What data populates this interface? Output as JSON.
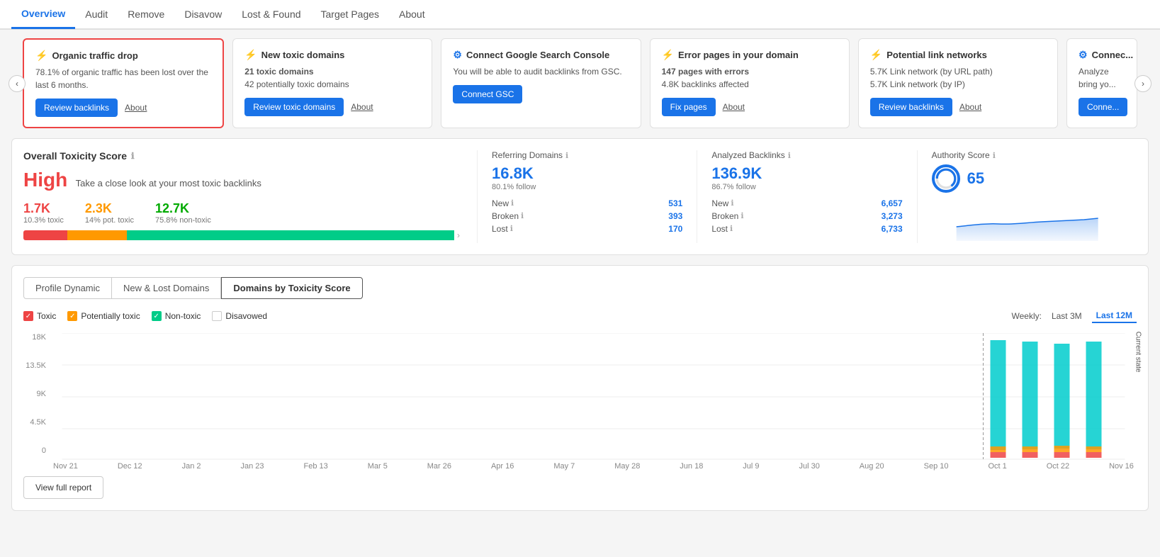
{
  "nav": {
    "items": [
      "Overview",
      "Audit",
      "Remove",
      "Disavow",
      "Lost & Found",
      "Target Pages",
      "About"
    ],
    "active": "Overview"
  },
  "cards": [
    {
      "id": "organic-traffic-drop",
      "icon": "alert",
      "title": "Organic traffic drop",
      "body": "78.1% of organic traffic has been lost over the last 6 months.",
      "actions": [
        {
          "label": "Review backlinks",
          "type": "btn"
        },
        {
          "label": "About",
          "type": "link"
        }
      ],
      "highlighted": true
    },
    {
      "id": "new-toxic-domains",
      "icon": "alert",
      "title": "New toxic domains",
      "stats": [
        "21 toxic domains",
        "42 potentially toxic domains"
      ],
      "actions": [
        {
          "label": "Review toxic domains",
          "type": "btn"
        },
        {
          "label": "About",
          "type": "link"
        }
      ],
      "highlighted": false
    },
    {
      "id": "connect-gsc",
      "icon": "settings",
      "title": "Connect Google Search Console",
      "body": "You will be able to audit backlinks from GSC.",
      "actions": [
        {
          "label": "Connect GSC",
          "type": "btn"
        }
      ],
      "highlighted": false
    },
    {
      "id": "error-pages",
      "icon": "alert",
      "title": "Error pages in your domain",
      "stats": [
        "147 pages with errors",
        "4.8K backlinks affected"
      ],
      "actions": [
        {
          "label": "Fix pages",
          "type": "btn"
        },
        {
          "label": "About",
          "type": "link"
        }
      ],
      "highlighted": false
    },
    {
      "id": "link-networks",
      "icon": "alert",
      "title": "Potential link networks",
      "stats": [
        "5.7K Link network (by URL path)",
        "5.7K Link network (by IP)"
      ],
      "actions": [
        {
          "label": "Review backlinks",
          "type": "btn"
        },
        {
          "label": "About",
          "type": "link"
        }
      ],
      "highlighted": false
    },
    {
      "id": "connect-extra",
      "icon": "settings",
      "title": "Connec...",
      "body": "Analyze bring yo...",
      "actions": [
        {
          "label": "Conne...",
          "type": "btn"
        }
      ],
      "highlighted": false
    }
  ],
  "toxicity": {
    "title": "Overall Toxicity Score",
    "score_label": "High",
    "subtitle": "Take a close look at your most toxic backlinks",
    "stats": [
      {
        "value": "1.7K",
        "label": "10.3% toxic",
        "color": "red"
      },
      {
        "value": "2.3K",
        "label": "14% pot. toxic",
        "color": "orange"
      },
      {
        "value": "12.7K",
        "label": "75.8% non-toxic",
        "color": "green"
      }
    ],
    "bar": {
      "red": 1.7,
      "orange": 2.3,
      "green": 12.7
    }
  },
  "metrics": {
    "referring_domains": {
      "title": "Referring Domains",
      "main": "16.8K",
      "sub": "80.1% follow",
      "rows": [
        {
          "label": "New",
          "value": "531"
        },
        {
          "label": "Broken",
          "value": "393"
        },
        {
          "label": "Lost",
          "value": "170"
        }
      ]
    },
    "analyzed_backlinks": {
      "title": "Analyzed Backlinks",
      "main": "136.9K",
      "sub": "86.7% follow",
      "rows": [
        {
          "label": "New",
          "value": "6,657"
        },
        {
          "label": "Broken",
          "value": "3,273"
        },
        {
          "label": "Lost",
          "value": "6,733"
        }
      ]
    },
    "authority_score": {
      "title": "Authority Score",
      "main": "65"
    }
  },
  "tabs": {
    "items": [
      "Profile Dynamic",
      "New & Lost Domains",
      "Domains by Toxicity Score"
    ],
    "active": "Domains by Toxicity Score"
  },
  "legend": {
    "items": [
      {
        "label": "Toxic",
        "color": "red",
        "checked": true
      },
      {
        "label": "Potentially toxic",
        "color": "orange",
        "checked": true
      },
      {
        "label": "Non-toxic",
        "color": "green",
        "checked": true
      },
      {
        "label": "Disavowed",
        "color": "empty",
        "checked": false
      }
    ]
  },
  "time_controls": {
    "label": "Weekly:",
    "options": [
      "Last 3M",
      "Last 12M"
    ],
    "active": "Last 12M"
  },
  "chart": {
    "y_labels": [
      "18K",
      "13.5K",
      "9K",
      "4.5K",
      "0"
    ],
    "x_labels": [
      "Nov 21",
      "Dec 12",
      "Jan 2",
      "Jan 23",
      "Feb 13",
      "Mar 5",
      "Mar 26",
      "Apr 16",
      "May 7",
      "May 28",
      "Jun 18",
      "Jul 9",
      "Jul 30",
      "Aug 20",
      "Sep 10",
      "Oct 1",
      "Oct 22",
      "Nov 16"
    ],
    "current_state_label": "Current state"
  },
  "view_report": "View full report"
}
